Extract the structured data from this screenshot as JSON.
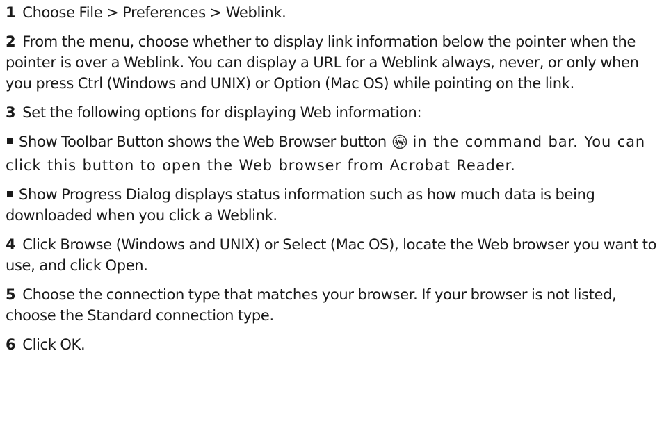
{
  "steps": [
    {
      "number": "1",
      "text": "Choose File > Preferences > Weblink."
    },
    {
      "number": "2",
      "text": "From the menu, choose whether to display link information below the pointer when the pointer is over a Weblink. You can display a URL for a Weblink always, never, or only when you press Ctrl (Windows and UNIX) or Option (Mac OS) while pointing on the link."
    },
    {
      "number": "3",
      "text": "Set the following options for displaying Web information:"
    },
    {
      "number": "4",
      "text": "Click Browse (Windows and UNIX) or Select (Mac OS), locate the Web browser you want to use, and click Open."
    },
    {
      "number": "5",
      "text": "Choose the connection type that matches your browser. If your browser is not listed, choose the Standard connection type."
    },
    {
      "number": "6",
      "text": "Click OK."
    }
  ],
  "bullets": [
    {
      "text_before_icon": "Show Toolbar Button shows the Web Browser button",
      "icon": "web-browser-icon",
      "text_after_icon": "in the command bar. You can click this button to open the Web browser from Acrobat Reader."
    },
    {
      "text": "Show Progress Dialog displays status information such as how much data is being downloaded when you click a Weblink."
    }
  ]
}
